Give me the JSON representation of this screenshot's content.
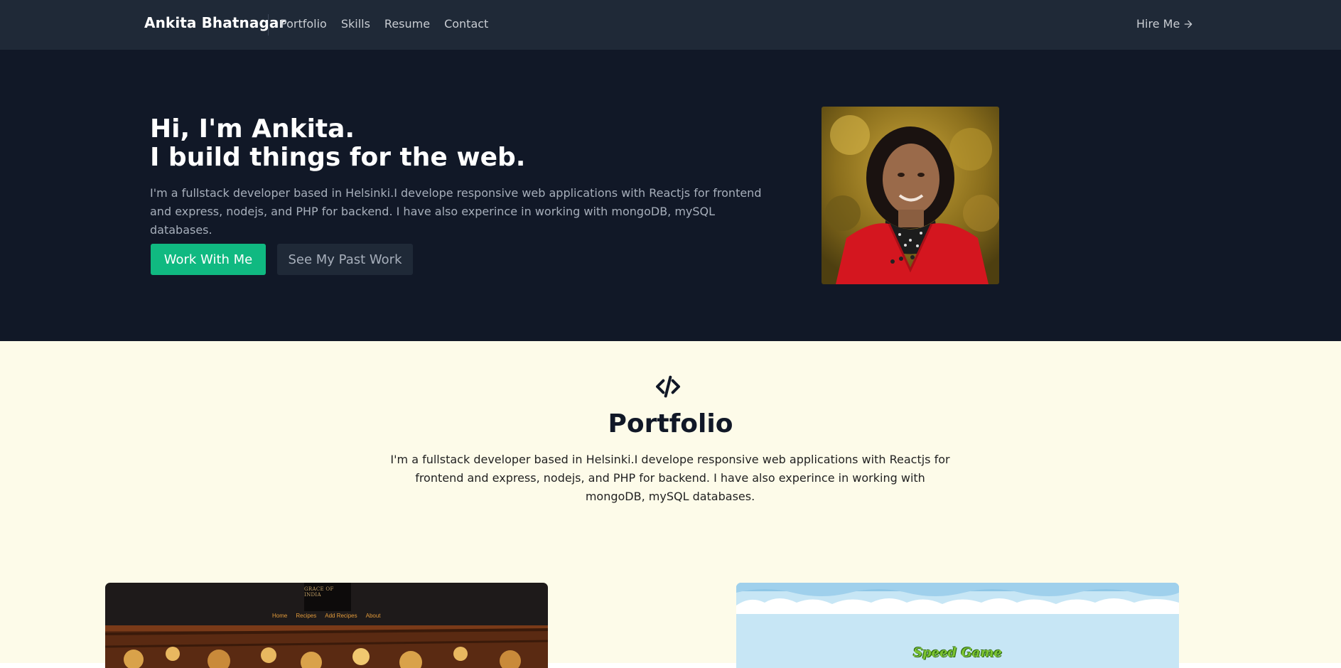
{
  "nav": {
    "brand": "Ankita Bhatnagar",
    "links": [
      "Portfolio",
      "Skills",
      "Resume",
      "Contact"
    ],
    "cta": "Hire Me",
    "cta_icon": "arrow-right-icon"
  },
  "hero": {
    "title_line1": "Hi, I'm Ankita.",
    "title_line2": "I build things for the web.",
    "description": "I'm a fullstack developer based in Helsinki.I develope responsive web applications with Reactjs for frontend and express, nodejs, and PHP for backend. I have also experince in working with mongoDB, mySQL databases.",
    "primary_button": "Work With Me",
    "secondary_button": "See My Past Work",
    "photo_icon": "profile-photo"
  },
  "portfolio": {
    "icon": "code-icon",
    "title": "Portfolio",
    "description": "I'm a fullstack developer based in Helsinki.I develope responsive web applications with Reactjs for frontend and express, nodejs, and PHP for backend. I have also experince in working with mongoDB, mySQL databases.",
    "projects": [
      {
        "logo_text": "GRACE OF INDIA",
        "nav": [
          "Home",
          "Recipes",
          "Add Recipes",
          "About"
        ]
      },
      {
        "title": "Speed Game"
      }
    ]
  },
  "colors": {
    "navbar": "#1f2937",
    "hero_bg": "#111827",
    "accent": "#10b981",
    "portfolio_bg": "#fdfbe9"
  }
}
